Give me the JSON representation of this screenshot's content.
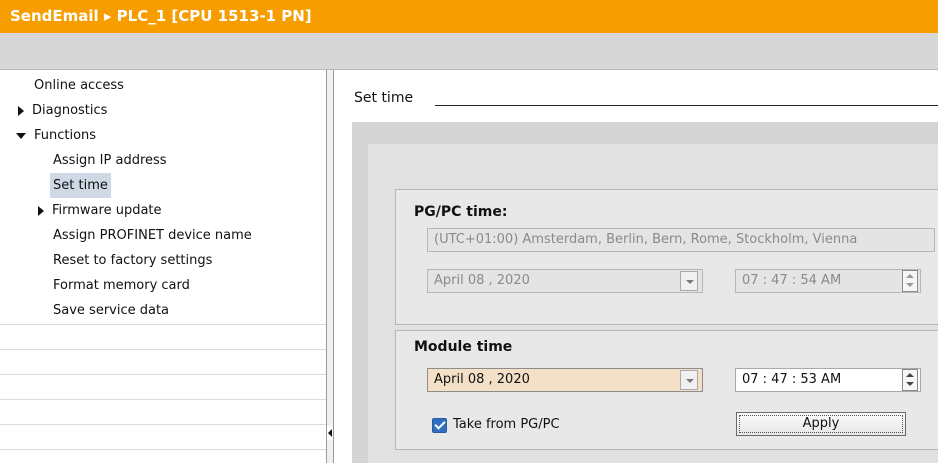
{
  "breadcrumb": {
    "title": "SendEmail ▸ PLC_1 [CPU 1513-1 PN]"
  },
  "nav": {
    "items": [
      {
        "label": "Online access"
      },
      {
        "label": "Diagnostics"
      },
      {
        "label": "Functions"
      },
      {
        "label": "Assign IP address"
      },
      {
        "label": "Set time"
      },
      {
        "label": "Firmware update"
      },
      {
        "label": "Assign PROFINET device name"
      },
      {
        "label": "Reset to factory settings"
      },
      {
        "label": "Format memory card"
      },
      {
        "label": "Save service data"
      }
    ]
  },
  "main": {
    "section_title": "Set time",
    "pgpc": {
      "title": "PG/PC time:",
      "timezone": "(UTC+01:00) Amsterdam, Berlin, Bern, Rome, Stockholm, Vienna",
      "date": "April  08 ,  2020",
      "time": "07 : 47 : 54    AM"
    },
    "module": {
      "title": "Module time",
      "date": "April  08 ,  2020",
      "time": "07 : 47 : 53    AM",
      "take_from_label": "Take from PG/PC",
      "take_from_checked": true,
      "apply_label": "Apply"
    }
  },
  "colors": {
    "title_bar": "#f79d00",
    "selected_nav": "#cfd9e6",
    "active_field": "#f4e0c6"
  }
}
